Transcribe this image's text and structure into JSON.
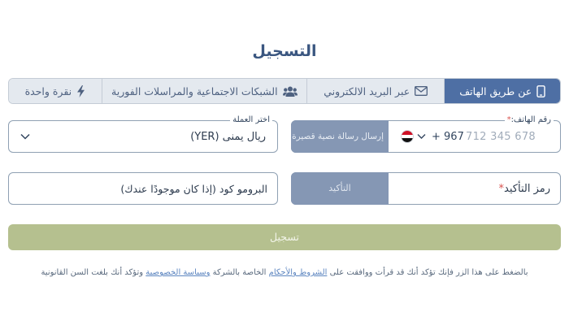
{
  "title": "التسجيل",
  "tabs": [
    {
      "label": "عن طريق الهاتف",
      "icon": "mobile-phone-icon",
      "active": true
    },
    {
      "label": "عبر البريد الالكتروني",
      "icon": "envelope-icon",
      "active": false
    },
    {
      "label": "الشبكات الاجتماعية والمراسلات الفورية",
      "icon": "users-icon",
      "active": false
    },
    {
      "label": "نقرة واحدة",
      "icon": "lightning-bolt-icon",
      "active": false
    }
  ],
  "phone": {
    "label": "رقم الهاتف:",
    "required_mark": "*",
    "country_code": "+ 967",
    "placeholder": "712 345 678",
    "sms_button": "إرسال رسالة نصية قصيرة",
    "flag": "yemen-flag-icon"
  },
  "currency": {
    "label": "اختر العملة",
    "value": "ريال يمنى (YER)"
  },
  "promo": {
    "placeholder": "البرومو كود (إذا كان موجودًا عندك)"
  },
  "code": {
    "label": "رمز التأكيد",
    "required_mark": "*",
    "confirm_button": "التأكيد"
  },
  "register_button": "تسجيل",
  "terms": {
    "prefix": "بالضغط على هذا الزر فإنك تؤكد أنك قد قرأت ووافقت على",
    "terms_link": "الشروط والأحكام",
    "middle": "الخاصة بالشركة",
    "privacy_link": "وسياسة الخصوصية",
    "suffix": "وتؤكد أنك بلغت السن القانونية"
  },
  "colors": {
    "primary": "#4e6fa4",
    "tab_bg": "#e4e9ef",
    "disabled_button": "#8597b4",
    "register_button": "#b5c08f",
    "title": "#3a5680",
    "required": "#d9534f"
  }
}
